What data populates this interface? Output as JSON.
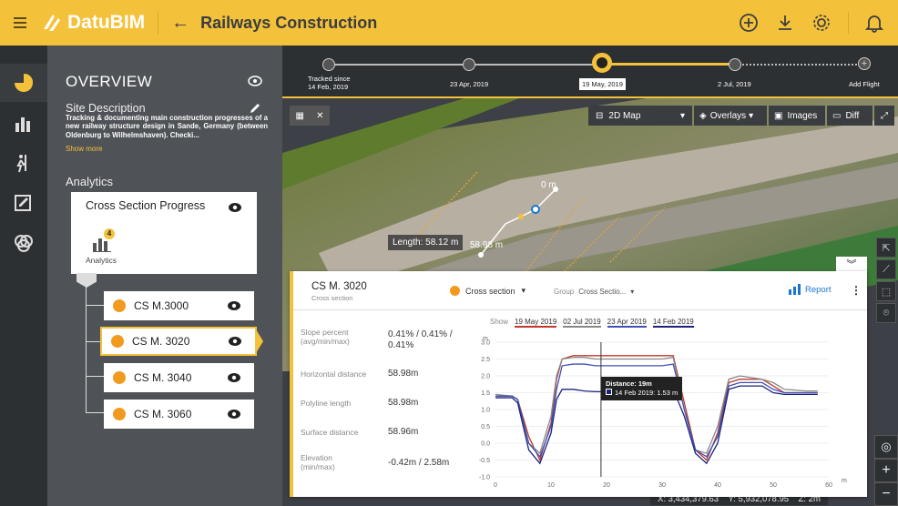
{
  "app": {
    "brand": "DatuBIM",
    "project_title": "Railways Construction"
  },
  "colors": {
    "accent": "#f4c13a",
    "orange": "#f29a1f",
    "blue": "#1976d2"
  },
  "timeline": {
    "items": [
      {
        "label": "Tracked since\n14 Feb, 2019"
      },
      {
        "label": "23 Apr, 2019"
      },
      {
        "label": "19 May, 2019"
      },
      {
        "label": "2 Jul, 2019"
      },
      {
        "label": "Add Flight"
      }
    ]
  },
  "overview": {
    "title": "OVERVIEW",
    "site_description_title": "Site Description",
    "site_description_text": "Tracking & documenting main construction progresses of a new railway structure design in Sande, Germany (between Oldenburg to Wilhelmshaven). Checki...",
    "show_more": "Show more",
    "analytics_title": "Analytics",
    "card_title": "Cross Section Progress",
    "card_badge": "4",
    "card_sub": "Analytics",
    "sections": [
      {
        "label": "CS M.3000"
      },
      {
        "label": "CS M. 3020"
      },
      {
        "label": "CS M. 3040"
      },
      {
        "label": "CS M. 3060"
      }
    ]
  },
  "map": {
    "view_select": "2D Map",
    "overlays": "Overlays",
    "images": "Images",
    "diff": "Diff",
    "measure_0": "0 m",
    "length_label": "Length: 58.12 m",
    "measure_end": "58.98 m",
    "coords": "X: 3,434,379.63    Y: 5,932,078.95    Z: 2m"
  },
  "panel": {
    "title": "CS M. 3020",
    "subtitle": "Cross section",
    "layer_select": "Cross section",
    "group_label": "Group",
    "group_value": "Cross Sectio...",
    "report": "Report",
    "show_label": "Show",
    "metrics": [
      {
        "label": "Slope percent\n(avg/min/max)",
        "value": "0.41% / 0.41% /\n0.41%"
      },
      {
        "label": "Horizontal distance",
        "value": "58.98m"
      },
      {
        "label": "Polyline length",
        "value": "58.98m"
      },
      {
        "label": "Surface distance",
        "value": "58.96m"
      },
      {
        "label": "Elevation\n(min/max)",
        "value": "-0.42m / 2.58m"
      }
    ],
    "tooltip_line1": "Distance: 19m",
    "tooltip_line2": "14 Feb 2019: 1.53 m"
  },
  "chart_data": {
    "type": "line",
    "ylabel": "m",
    "xlabel": "m",
    "xlim": [
      0,
      60
    ],
    "ylim": [
      -1.0,
      3.0
    ],
    "x_ticks": [
      0,
      10,
      20,
      30,
      40,
      50,
      60
    ],
    "y_ticks": [
      3.0,
      2.5,
      2.0,
      1.5,
      1.0,
      0.5,
      0.0,
      -0.5,
      -1.0
    ],
    "cursor_x": 19,
    "series": [
      {
        "name": "19 May 2019",
        "color": "#c0392b",
        "x": [
          0,
          3,
          4,
          6,
          8,
          10,
          11,
          12,
          14,
          16,
          18,
          20,
          24,
          30,
          32,
          34,
          36,
          38,
          40,
          42,
          44,
          48,
          50,
          52,
          56,
          58
        ],
        "y": [
          1.4,
          1.4,
          1.3,
          0.2,
          -0.5,
          0.6,
          1.9,
          2.5,
          2.6,
          2.6,
          2.6,
          2.6,
          2.6,
          2.6,
          2.6,
          1.2,
          -0.2,
          -0.5,
          0.3,
          1.8,
          1.9,
          1.9,
          1.7,
          1.5,
          1.5,
          1.5
        ]
      },
      {
        "name": "02 Jul 2019",
        "color": "#888888",
        "x": [
          0,
          3,
          4,
          6,
          8,
          10,
          11,
          12,
          14,
          16,
          18,
          20,
          24,
          30,
          32,
          34,
          36,
          38,
          40,
          42,
          44,
          48,
          50,
          52,
          56,
          58
        ],
        "y": [
          1.45,
          1.4,
          1.3,
          0.0,
          -0.3,
          0.8,
          2.0,
          2.5,
          2.55,
          2.55,
          2.5,
          2.5,
          2.5,
          2.5,
          2.55,
          1.0,
          -0.2,
          -0.3,
          0.5,
          1.9,
          2.0,
          1.9,
          1.8,
          1.6,
          1.55,
          1.55
        ]
      },
      {
        "name": "23 Apr 2019",
        "color": "#3f51b5",
        "x": [
          0,
          3,
          4,
          6,
          8,
          10,
          11,
          12,
          14,
          16,
          18,
          20,
          24,
          30,
          32,
          34,
          36,
          38,
          40,
          42,
          44,
          48,
          50,
          52,
          56,
          58
        ],
        "y": [
          1.4,
          1.4,
          1.3,
          0.0,
          -0.4,
          0.5,
          1.6,
          2.3,
          2.35,
          2.35,
          2.3,
          2.3,
          2.3,
          2.3,
          2.35,
          1.0,
          -0.2,
          -0.4,
          0.2,
          1.7,
          1.8,
          1.8,
          1.6,
          1.5,
          1.5,
          1.5
        ]
      },
      {
        "name": "14 Feb 2019",
        "color": "#1a237e",
        "x": [
          0,
          3,
          4,
          6,
          8,
          10,
          11,
          12,
          14,
          16,
          18,
          20,
          24,
          30,
          32,
          34,
          36,
          38,
          40,
          42,
          44,
          48,
          50,
          52,
          56,
          58
        ],
        "y": [
          1.35,
          1.35,
          1.2,
          -0.2,
          -0.6,
          0.3,
          1.3,
          1.6,
          1.6,
          1.55,
          1.53,
          1.53,
          1.55,
          1.55,
          1.6,
          0.8,
          -0.3,
          -0.6,
          0.0,
          1.6,
          1.7,
          1.7,
          1.5,
          1.45,
          1.45,
          1.45
        ]
      }
    ]
  }
}
